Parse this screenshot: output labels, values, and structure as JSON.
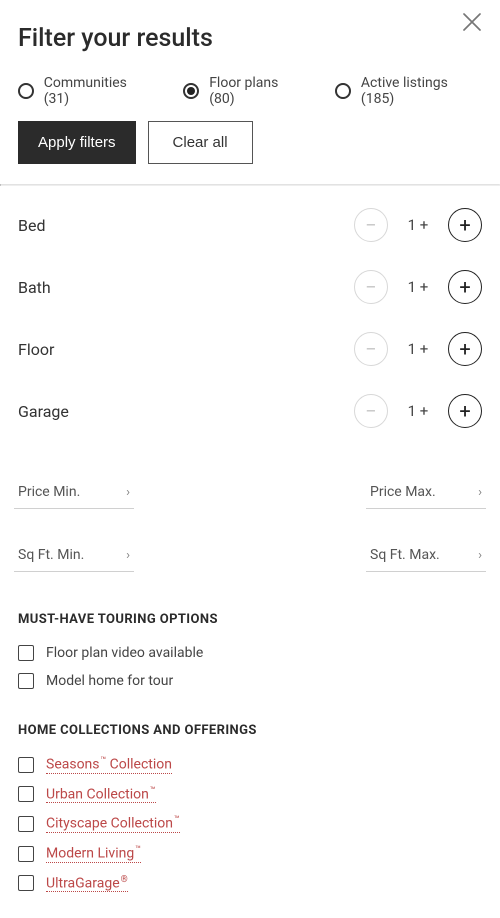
{
  "header": {
    "title": "Filter your results"
  },
  "tabs": {
    "communities": "Communities (31)",
    "floorplans": "Floor plans (80)",
    "listings": "Active listings (185)"
  },
  "actions": {
    "apply": "Apply filters",
    "clear": "Clear all"
  },
  "steppers": {
    "bed": {
      "label": "Bed",
      "value": "1 +"
    },
    "bath": {
      "label": "Bath",
      "value": "1 +"
    },
    "floor": {
      "label": "Floor",
      "value": "1 +"
    },
    "garage": {
      "label": "Garage",
      "value": "1 +"
    }
  },
  "ranges": {
    "price_min": "Price Min.",
    "price_max": "Price Max.",
    "sqft_min": "Sq Ft. Min.",
    "sqft_max": "Sq Ft. Max."
  },
  "touring": {
    "heading": "MUST-HAVE TOURING OPTIONS",
    "video": "Floor plan video available",
    "model": "Model home for tour"
  },
  "collections": {
    "heading": "HOME COLLECTIONS AND OFFERINGS",
    "seasons": {
      "label": "Seasons",
      "mark": "™",
      "suffix": " Collection"
    },
    "urban": {
      "label": "Urban Collection",
      "mark": "™",
      "suffix": ""
    },
    "cityscape": {
      "label": "Cityscape Collection",
      "mark": "™",
      "suffix": ""
    },
    "modern": {
      "label": "Modern Living",
      "mark": "™",
      "suffix": ""
    },
    "ultragarage": {
      "label": "UltraGarage",
      "mark": "®",
      "suffix": ""
    }
  }
}
